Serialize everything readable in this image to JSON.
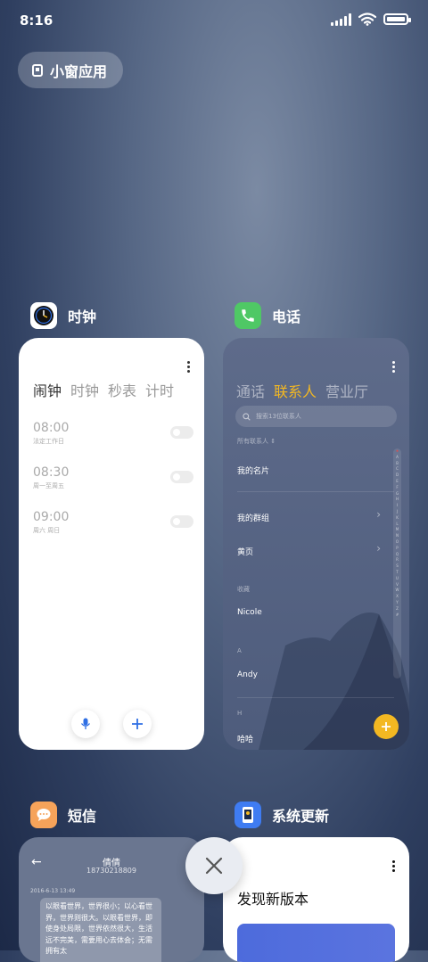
{
  "status": {
    "time": "8:16"
  },
  "small_window": {
    "label": "小窗应用"
  },
  "apps": {
    "clock": {
      "name": "时钟",
      "tabs": [
        "闹钟",
        "时钟",
        "秒表",
        "计时"
      ],
      "alarms": [
        {
          "time": "08:00",
          "desc": "法定工作日"
        },
        {
          "time": "08:30",
          "desc": "周一至周五"
        },
        {
          "time": "09:00",
          "desc": "周六 周日"
        }
      ]
    },
    "phone": {
      "name": "电话",
      "tabs": [
        "通话",
        "联系人",
        "营业厅"
      ],
      "search_placeholder": "搜索13位联系人",
      "all_contacts": "所有联系人",
      "my_card": "我的名片",
      "my_groups": "我的群组",
      "yellow_pages": "黄页",
      "favorites_header": "收藏",
      "favorite": "Nicole",
      "section_a": "A",
      "contact_a": "Andy",
      "section_h": "H",
      "contact_h": "哈哈",
      "index_letters": [
        "★",
        "A",
        "B",
        "C",
        "D",
        "E",
        "F",
        "G",
        "H",
        "I",
        "J",
        "K",
        "L",
        "M",
        "N",
        "O",
        "P",
        "Q",
        "R",
        "S",
        "T",
        "U",
        "V",
        "W",
        "X",
        "Y",
        "Z",
        "#"
      ]
    },
    "sms": {
      "name": "短信",
      "contact_name": "倩倩",
      "contact_number": "18730218809",
      "date": "2016-6-13 13:49",
      "message": "以眼看世界，世界很小；以心看世界，世界则很大。以眼看世界，即使身处局限，世界依然很大，生活远不完美，需要用心去体会；无需拥有太"
    },
    "update": {
      "name": "系统更新",
      "title": "发现新版本"
    }
  },
  "colors": {
    "accent": "#f3b822",
    "clock_blue": "#2f6fe4",
    "phone_green": "#4fc865"
  }
}
